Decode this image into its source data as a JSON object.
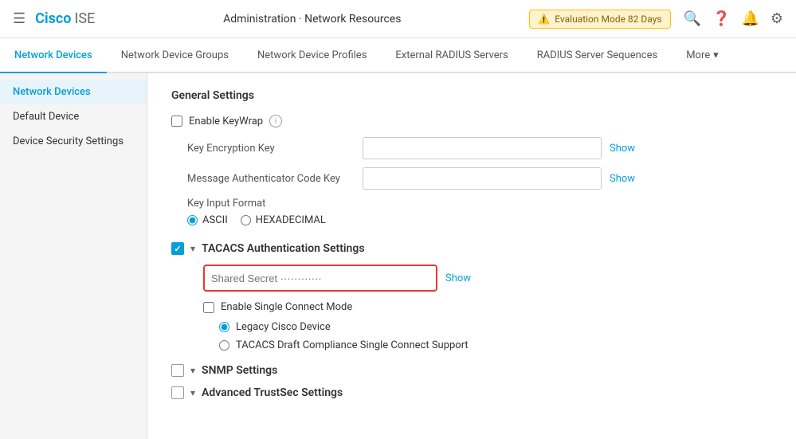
{
  "header": {
    "menu_icon": "☰",
    "logo_cisco": "Cisco",
    "logo_ise": "ISE",
    "title": "Administration · Network Resources",
    "eval_warning": "⚠",
    "eval_text": "Evaluation Mode 82 Days",
    "icons": {
      "search": "🔍",
      "help": "?",
      "notifications": "🔔",
      "settings": "⚙"
    }
  },
  "nav_tabs": [
    {
      "label": "Network Devices",
      "active": true
    },
    {
      "label": "Network Device Groups",
      "active": false
    },
    {
      "label": "Network Device Profiles",
      "active": false
    },
    {
      "label": "External RADIUS Servers",
      "active": false
    },
    {
      "label": "RADIUS Server Sequences",
      "active": false
    },
    {
      "label": "More",
      "active": false,
      "has_arrow": true
    }
  ],
  "sidebar": {
    "items": [
      {
        "label": "Network Devices",
        "active": true
      },
      {
        "label": "Default Device",
        "active": false
      },
      {
        "label": "Device Security Settings",
        "active": false
      }
    ]
  },
  "content": {
    "general_settings": {
      "title": "General Settings",
      "enable_keywrap_label": "Enable KeyWrap",
      "info_icon": "i",
      "key_encryption_key_label": "Key Encryption Key",
      "key_encryption_key_placeholder": "",
      "show_kek": "Show",
      "message_auth_label": "Message Authenticator Code Key",
      "message_auth_placeholder": "",
      "show_mac": "Show",
      "key_input_format_label": "Key Input Format",
      "radio_ascii": "ASCII",
      "radio_hex": "HEXADECIMAL",
      "ascii_selected": true
    },
    "tacacs_section": {
      "title": "TACACS Authentication Settings",
      "checked": true,
      "shared_secret_label": "Shared Secret",
      "shared_secret_dots": "············",
      "show_secret": "Show",
      "enable_single_connect_label": "Enable Single Connect Mode",
      "radio_legacy": "Legacy Cisco Device",
      "radio_draft": "TACACS Draft Compliance Single Connect Support",
      "legacy_selected": true
    },
    "snmp_section": {
      "title": "SNMP Settings",
      "checked": false
    },
    "advanced_section": {
      "title": "Advanced TrustSec Settings",
      "checked": false
    }
  }
}
